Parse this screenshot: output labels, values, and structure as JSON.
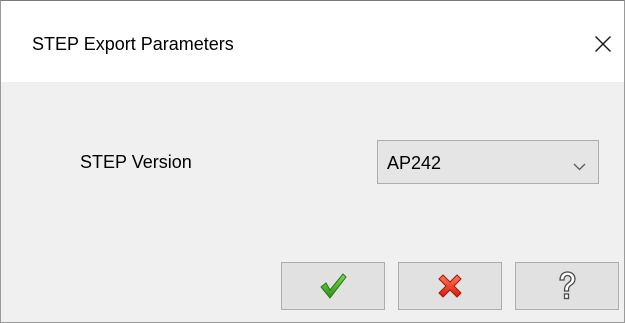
{
  "window": {
    "title": "STEP Export Parameters",
    "close_icon": "close-icon"
  },
  "form": {
    "step_version_label": "STEP Version",
    "step_version_value": "AP242",
    "step_version_icon": "chevron-down-icon"
  },
  "buttons": {
    "ok_icon": "green-checkmark-icon",
    "cancel_icon": "red-x-icon",
    "help_icon": "question-mark-icon"
  },
  "colors": {
    "ok_green": "#3aa321",
    "cancel_red": "#e5301c",
    "help_gray": "#6e6e6e"
  }
}
